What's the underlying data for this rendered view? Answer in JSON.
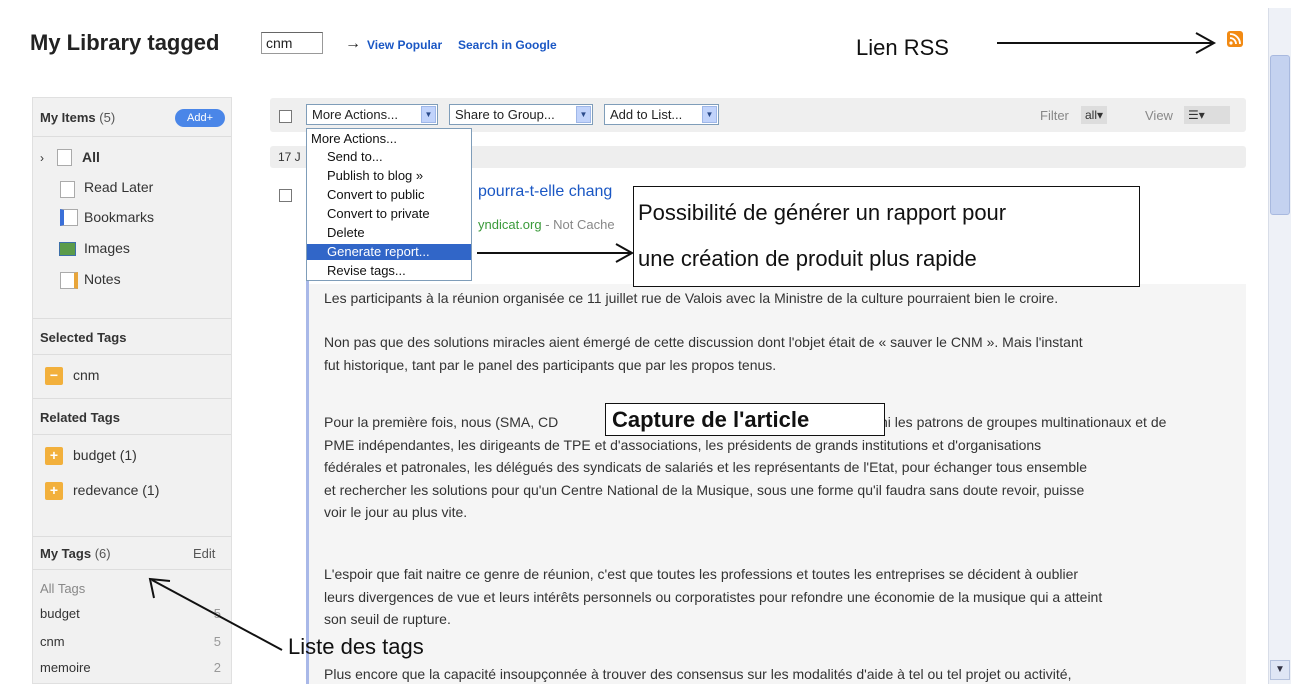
{
  "header": {
    "title": "My Library tagged",
    "tag_value": "cnm",
    "arrow": "→",
    "view_popular": "View Popular",
    "search_google": "Search in Google"
  },
  "sidebar": {
    "my_items": {
      "label": "My Items",
      "count": "(5)",
      "add_label": "Add+"
    },
    "items": [
      {
        "label": "All",
        "icon": "document-icon"
      },
      {
        "label": "Read Later",
        "icon": "clock-document-icon"
      },
      {
        "label": "Bookmarks",
        "icon": "bookmark-icon"
      },
      {
        "label": "Images",
        "icon": "image-icon"
      },
      {
        "label": "Notes",
        "icon": "note-icon"
      }
    ],
    "selected_tags": {
      "label": "Selected Tags",
      "tags": [
        {
          "label": "cnm",
          "sign": "−"
        }
      ]
    },
    "related_tags": {
      "label": "Related Tags",
      "tags": [
        {
          "label": "budget (1)",
          "sign": "+"
        },
        {
          "label": "redevance (1)",
          "sign": "+"
        }
      ]
    },
    "my_tags": {
      "label": "My Tags",
      "count": "(6)",
      "edit_label": "Edit",
      "all_tags_label": "All Tags",
      "tags": [
        {
          "label": "budget",
          "count": "5"
        },
        {
          "label": "cnm",
          "count": "5"
        },
        {
          "label": "memoire",
          "count": "2"
        }
      ]
    }
  },
  "toolbar": {
    "more_actions": "More Actions...",
    "share_group": "Share to Group...",
    "add_list": "Add to List...",
    "filter_label": "Filter",
    "filter_value": "all▾",
    "view_label": "View",
    "view_value": "☰▾"
  },
  "menu": {
    "items": [
      {
        "label": "More Actions..."
      },
      {
        "label": "Send to..."
      },
      {
        "label": "Publish to blog »"
      },
      {
        "label": "Convert to public"
      },
      {
        "label": "Convert to private"
      },
      {
        "label": "Delete"
      },
      {
        "label": "Generate report...",
        "selected": true
      },
      {
        "label": "Revise tags..."
      }
    ]
  },
  "list": {
    "date": "17 J",
    "item_title": "pourra-t-elle chang",
    "item_url": "yndicat.org",
    "item_cache": " - Not Cache"
  },
  "article": {
    "paragraphs": [
      [
        "Les participants à la réunion organisée ce 11 juillet rue de Valois avec la Ministre de la culture pourraient bien le croire."
      ],
      [
        "Non pas que des solutions miracles aient émergé de cette discussion dont l'objet était de « sauver le CNM ». Mais l'instant",
        "fut historique, tant par le panel des participants que par les propos tenus."
      ],
      [
        "Pour la première fois, nous (SMA, CD",
        "ni les patrons de groupes multinationaux et de",
        "PME indépendantes, les dirigeants de TPE et d'associations, les présidents de grands institutions et d'organisations",
        "fédérales et patronales, les délégués des syndicats de salariés et les représentants de l'Etat, pour échanger tous ensemble",
        "et rechercher les solutions pour qu'un Centre National de la Musique, sous une forme qu'il faudra sans doute revoir, puisse",
        "voir le jour au plus vite."
      ],
      [
        "L'espoir que fait naitre ce genre de réunion, c'est que toutes les professions et toutes les entreprises se décident à oublier",
        "leurs divergences de vue et leurs intérêts personnels ou corporatistes pour refondre une économie de la musique qui a atteint",
        "son seuil de rupture."
      ],
      [
        "Plus encore que la capacité insoupçonnée à trouver des consensus sur les modalités d'aide à tel ou tel projet ou activité,"
      ]
    ]
  },
  "annotations": {
    "lien_rss": "Lien RSS",
    "report_line1": "Possibilité de générer un rapport pour",
    "report_line2": "une création de produit plus rapide",
    "capture": "Capture de l'article",
    "liste_tags": "Liste des tags"
  },
  "colors": {
    "accent": "#1a57c4",
    "menu_selected": "#3166c8",
    "rss": "#f28a13",
    "tag_badge": "#f2b03c"
  }
}
